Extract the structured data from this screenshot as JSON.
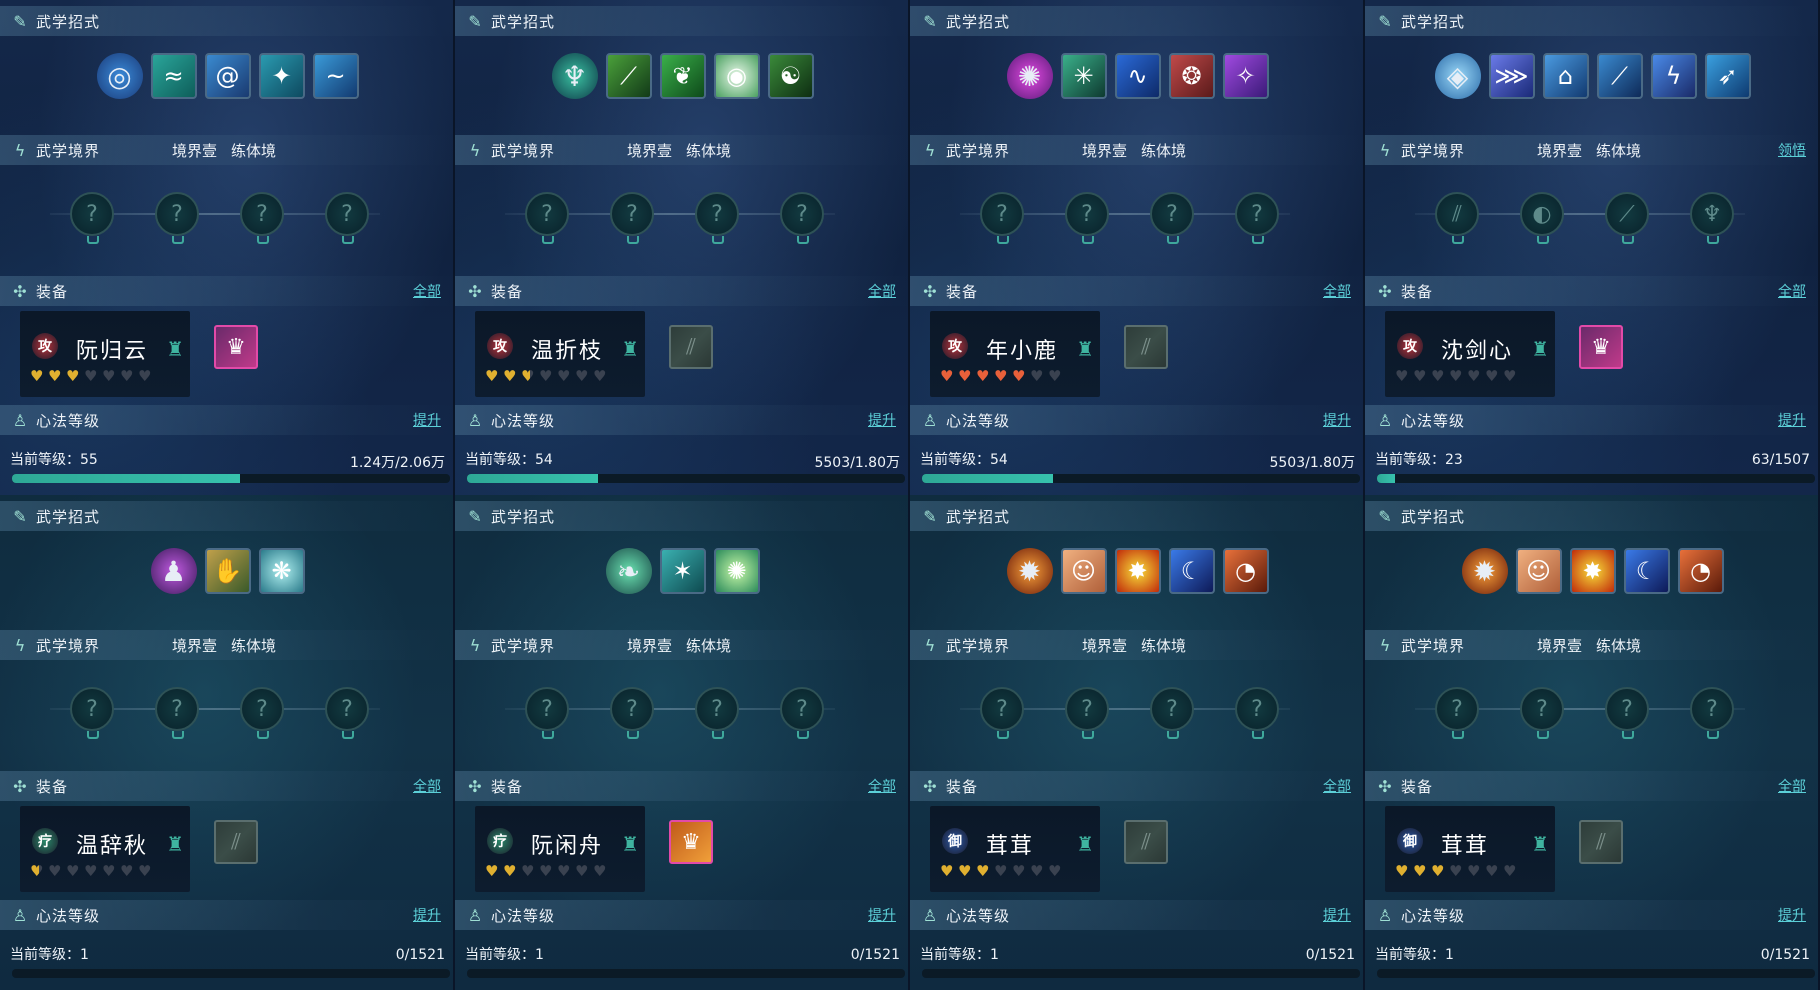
{
  "labels": {
    "moves": "武学招式",
    "realm": "武学境界",
    "realm_level": "境界壹",
    "realm_stage": "练体境",
    "equipment": "装备",
    "all": "全部",
    "heart_method": "心法等级",
    "upgrade": "提升",
    "current_level_prefix": "当前等级："
  },
  "panels": [
    {
      "skills": [
        "swirl-main",
        "wind-slash",
        "vortex",
        "star-dash",
        "wave"
      ],
      "realm_action": "",
      "character": {
        "name": "阮归云",
        "badge": "攻",
        "badge_color": "#b8323a",
        "hearts_filled": 3,
        "hearts_total": 7,
        "heart_color": "#e0b030"
      },
      "equip_slot": "filled",
      "level": "当前等级：55",
      "exp": "1.24万/2.06万",
      "progress": 0.52
    },
    {
      "skills": [
        "archer-main",
        "vine-strike",
        "leaf-blade",
        "ring-pulse",
        "yin-yang"
      ],
      "realm_action": "",
      "character": {
        "name": "温折枝",
        "badge": "攻",
        "badge_color": "#b8323a",
        "hearts_filled": 2.5,
        "hearts_total": 7,
        "heart_color": "#e0b030"
      },
      "equip_slot": "empty",
      "level": "当前等级：54",
      "exp": "5503/1.80万",
      "progress": 0.3
    },
    {
      "skills": [
        "purple-orb-main",
        "jade-burst",
        "blue-dragon",
        "crimson-beast",
        "violet-spirit"
      ],
      "realm_action": "",
      "character": {
        "name": "年小鹿",
        "badge": "攻",
        "badge_color": "#b8323a",
        "hearts_filled": 5,
        "hearts_total": 7,
        "heart_color": "#e8603a"
      },
      "equip_slot": "empty",
      "level": "当前等级：54",
      "exp": "5503/1.80万",
      "progress": 0.3
    },
    {
      "skills": [
        "water-orb-main",
        "ice-claw",
        "frost-ring",
        "sword-gust",
        "lightning-pillar",
        "azure-bird"
      ],
      "realm_action": "领悟",
      "character": {
        "name": "沈剑心",
        "badge": "攻",
        "badge_color": "#b8323a",
        "hearts_filled": 0,
        "hearts_total": 7,
        "heart_color": "#e0b030"
      },
      "equip_slot": "filled",
      "level": "当前等级：23",
      "exp": "63/1507",
      "progress": 0.04
    },
    {
      "skills": [
        "shadow-mage-main",
        "golden-palm",
        "spirit-wheel"
      ],
      "realm_action": "",
      "character": {
        "name": "温辞秋",
        "badge": "疗",
        "badge_color": "#2a8a6a",
        "hearts_filled": 0.5,
        "hearts_total": 7,
        "heart_color": "#e0b030"
      },
      "equip_slot": "empty",
      "level": "当前等级：1",
      "exp": "0/1521",
      "progress": 0
    },
    {
      "skills": [
        "butterfly-main",
        "firefly",
        "green-bloom"
      ],
      "realm_action": "",
      "character": {
        "name": "阮闲舟",
        "badge": "疗",
        "badge_color": "#2a8a6a",
        "hearts_filled": 2,
        "hearts_total": 7,
        "heart_color": "#e0b030"
      },
      "equip_slot": "filled",
      "level": "当前等级：1",
      "exp": "0/1521",
      "progress": 0
    },
    {
      "skills": [
        "flame-monk-main",
        "buddha-face",
        "fire-burst",
        "crescent-moon",
        "fire-vortex"
      ],
      "realm_action": "",
      "character": {
        "name": "茸茸",
        "badge": "御",
        "badge_color": "#2b5aa8",
        "hearts_filled": 3,
        "hearts_total": 7,
        "heart_color": "#e0b030"
      },
      "equip_slot": "empty",
      "level": "当前等级：1",
      "exp": "0/1521",
      "progress": 0
    },
    {
      "skills": [
        "flame-monk-main",
        "buddha-face",
        "fire-burst",
        "crescent-moon",
        "fire-vortex"
      ],
      "realm_action": "",
      "character": {
        "name": "茸茸",
        "badge": "御",
        "badge_color": "#2b5aa8",
        "hearts_filled": 3,
        "hearts_total": 7,
        "heart_color": "#e0b030"
      },
      "equip_slot": "empty",
      "level": "当前等级：1",
      "exp": "0/1521",
      "progress": 0
    }
  ]
}
